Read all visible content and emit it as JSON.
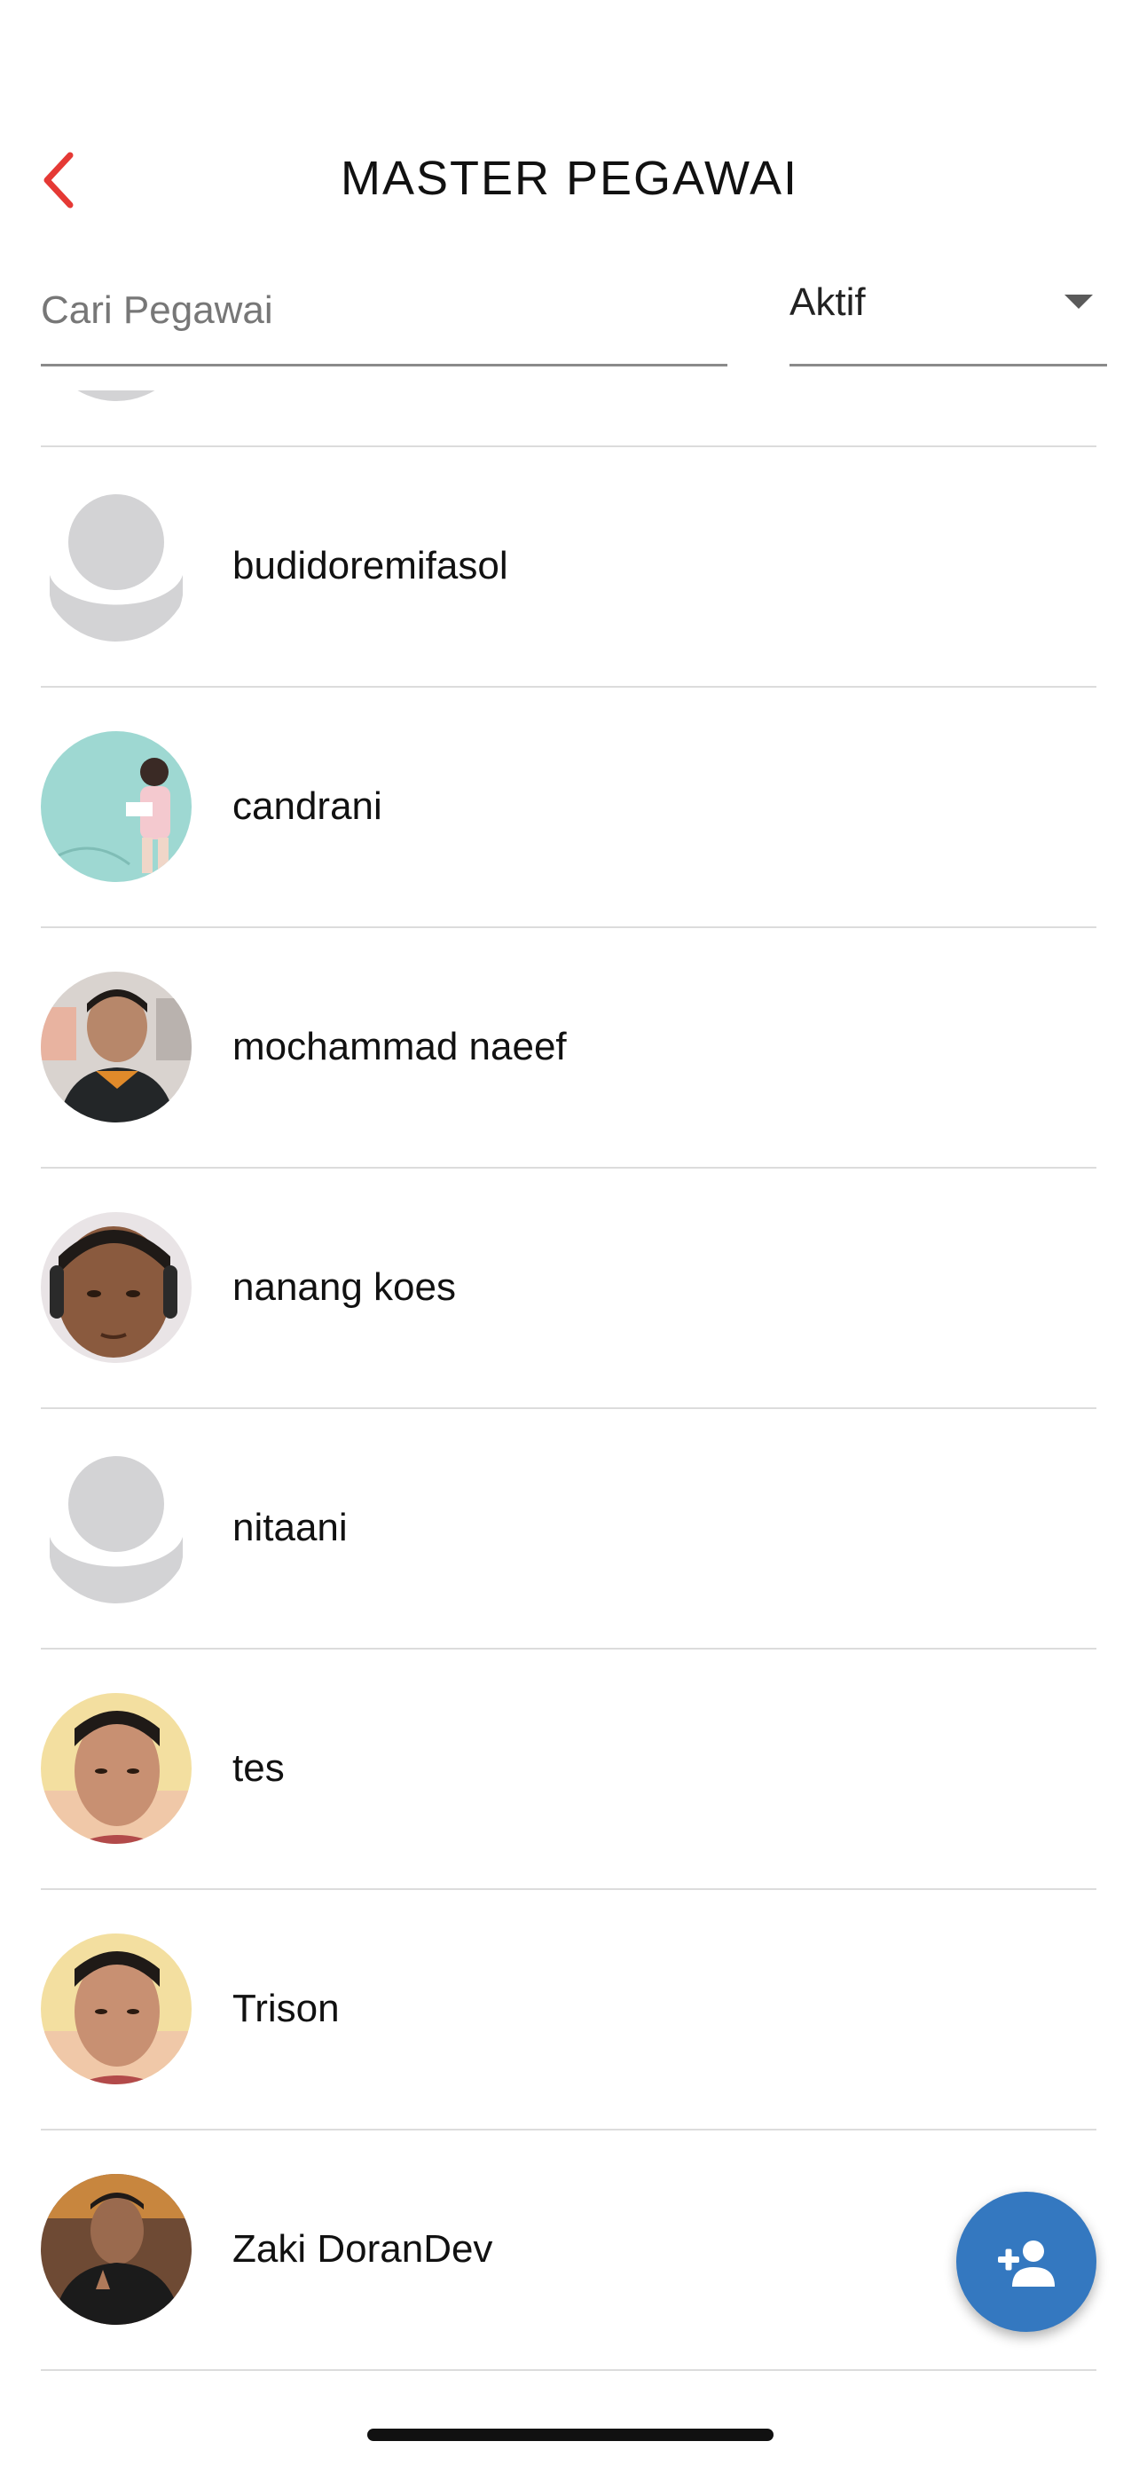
{
  "header": {
    "title": "MASTER PEGAWAI",
    "back_icon": "chevron-left-icon",
    "accent_color": "#e53935"
  },
  "search": {
    "placeholder": "Cari Pegawai",
    "value": ""
  },
  "filter": {
    "selected": "Aktif",
    "icon": "caret-down-icon"
  },
  "employees": [
    {
      "name": "",
      "avatar": "default-avatar"
    },
    {
      "name": "budidoremifasol",
      "avatar": "default-avatar"
    },
    {
      "name": "candrani",
      "avatar": "photo-avatar",
      "photo_color": "#9ed8d2"
    },
    {
      "name": "mochammad naeef",
      "avatar": "photo-avatar",
      "photo_color": "#2b2b2b"
    },
    {
      "name": "nanang koes",
      "avatar": "photo-avatar",
      "photo_color": "#6b4a3a"
    },
    {
      "name": "nitaani",
      "avatar": "default-avatar"
    },
    {
      "name": "tes",
      "avatar": "photo-avatar",
      "photo_color": "#f3dfa0"
    },
    {
      "name": "Trison",
      "avatar": "photo-avatar",
      "photo_color": "#f3dfa0"
    },
    {
      "name": "Zaki DoranDev",
      "avatar": "photo-avatar",
      "photo_color": "#3a2a22"
    }
  ],
  "fab": {
    "icon": "add-person-icon",
    "color": "#3478c0"
  }
}
